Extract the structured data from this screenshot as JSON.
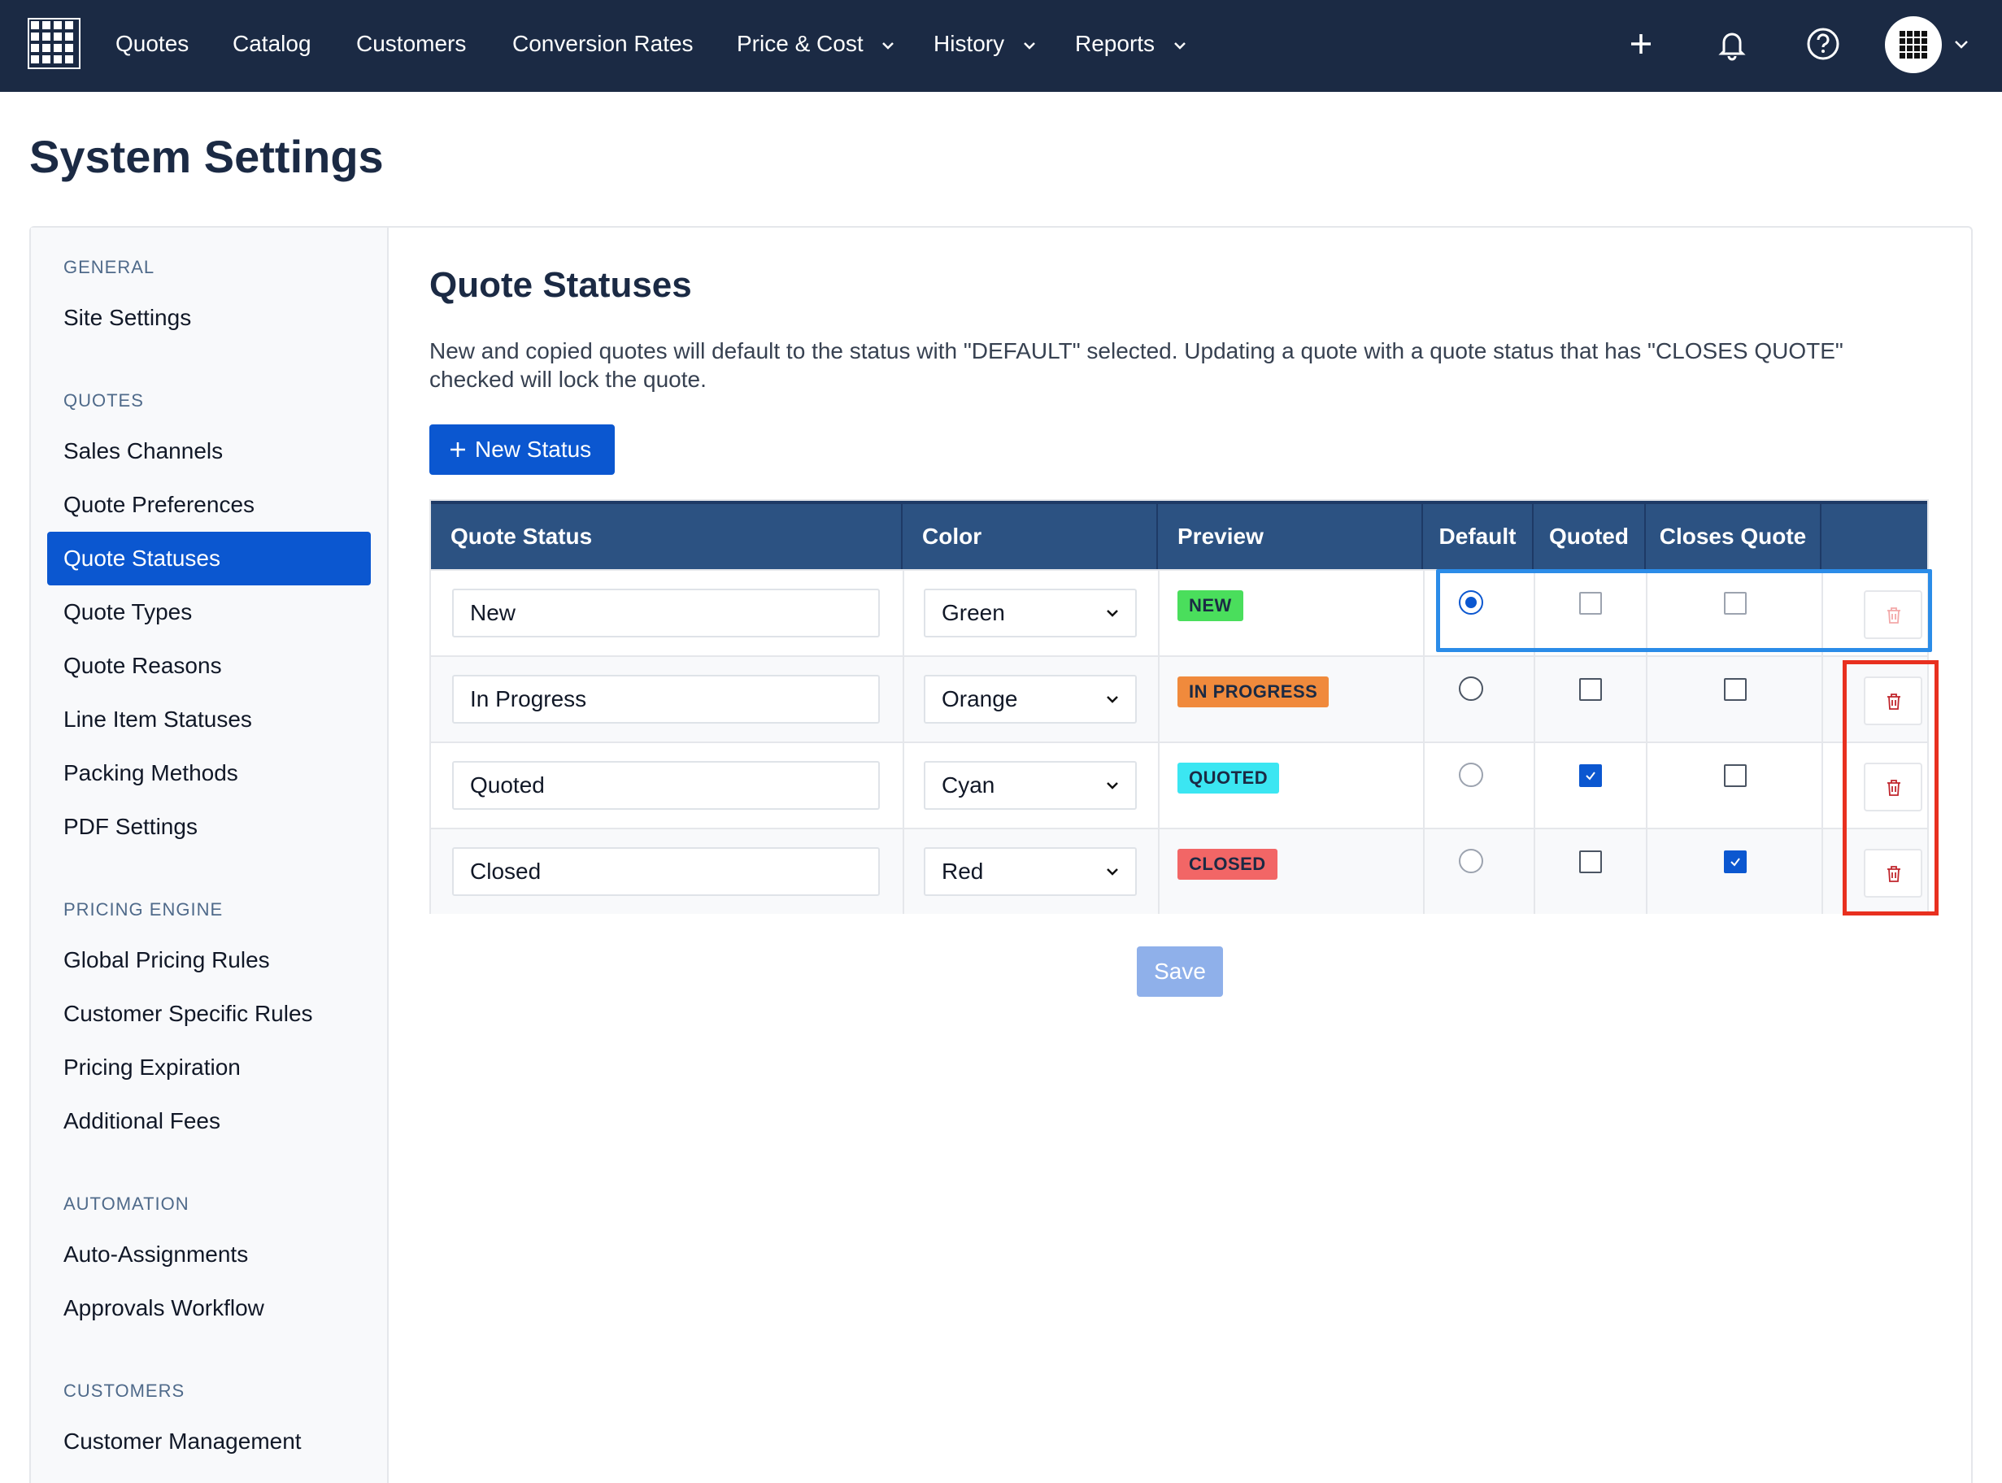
{
  "nav": {
    "items": [
      {
        "label": "Quotes"
      },
      {
        "label": "Catalog"
      },
      {
        "label": "Customers"
      },
      {
        "label": "Conversion Rates"
      },
      {
        "label": "Price & Cost",
        "dropdown": true
      },
      {
        "label": "History",
        "dropdown": true
      },
      {
        "label": "Reports",
        "dropdown": true
      }
    ],
    "icons": [
      "plus-icon",
      "bell-icon",
      "help-icon",
      "avatar-grid-icon"
    ]
  },
  "page": {
    "title": "System Settings"
  },
  "sidebar": {
    "sections": [
      {
        "title": "GENERAL",
        "items": [
          "Site Settings"
        ]
      },
      {
        "title": "QUOTES",
        "items": [
          "Sales Channels",
          "Quote Preferences",
          "Quote Statuses",
          "Quote Types",
          "Quote Reasons",
          "Line Item Statuses",
          "Packing Methods",
          "PDF Settings"
        ]
      },
      {
        "title": "PRICING ENGINE",
        "items": [
          "Global Pricing Rules",
          "Customer Specific Rules",
          "Pricing Expiration",
          "Additional Fees"
        ]
      },
      {
        "title": "AUTOMATION",
        "items": [
          "Auto-Assignments",
          "Approvals Workflow"
        ]
      },
      {
        "title": "CUSTOMERS",
        "items": [
          "Customer Management"
        ]
      }
    ],
    "active_item": "Quote Statuses"
  },
  "content": {
    "title": "Quote Statuses",
    "description": "New and copied quotes will default to the status with \"DEFAULT\" selected. Updating a quote with a quote status that has \"CLOSES QUOTE\" checked will lock the quote.",
    "new_button": "New Status",
    "save_button": "Save"
  },
  "table": {
    "headers": [
      "Quote Status",
      "Color",
      "Preview",
      "Default",
      "Quoted",
      "Closes Quote"
    ],
    "rows": [
      {
        "name": "New",
        "color": "Green",
        "preview": "NEW",
        "badge_color": "#4ade5c",
        "default": true,
        "quoted": false,
        "closes": false,
        "delete_enabled": false
      },
      {
        "name": "In Progress",
        "color": "Orange",
        "preview": "IN PROGRESS",
        "badge_color": "#f08a3c",
        "default": false,
        "quoted": false,
        "closes": false,
        "delete_enabled": true
      },
      {
        "name": "Quoted",
        "color": "Cyan",
        "preview": "QUOTED",
        "badge_color": "#3be6f2",
        "default": false,
        "quoted": true,
        "closes": false,
        "delete_enabled": true
      },
      {
        "name": "Closed",
        "color": "Red",
        "preview": "CLOSED",
        "badge_color": "#f26666",
        "default": false,
        "quoted": false,
        "closes": true,
        "delete_enabled": true
      }
    ]
  },
  "colors": {
    "topbar": "#1b2a44",
    "accent": "#0b57d0",
    "table_header": "#2c5282",
    "highlight_blue": "#2b8ce8",
    "highlight_red": "#e8301f"
  }
}
